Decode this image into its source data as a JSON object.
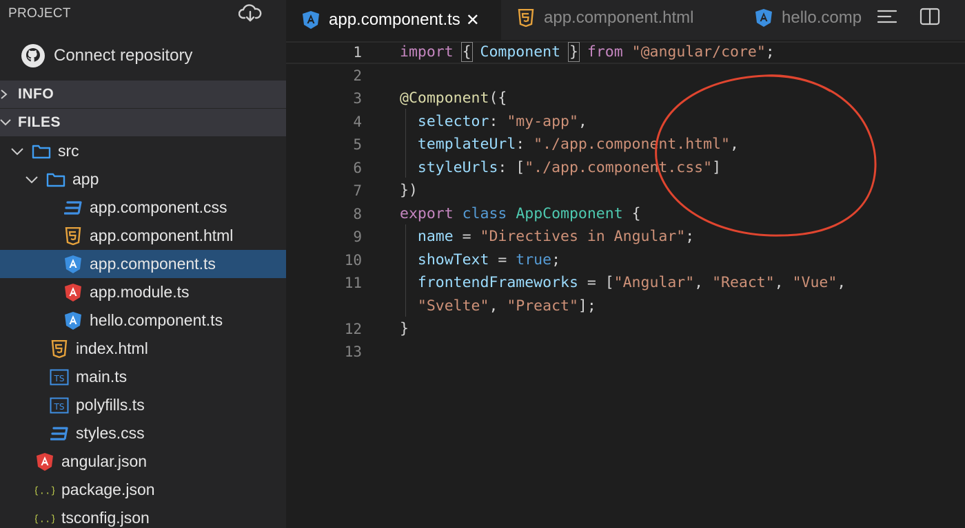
{
  "sidebar": {
    "title": "PROJECT",
    "connect_label": "Connect repository",
    "sections": {
      "info": "INFO",
      "files": "FILES"
    },
    "tree": [
      {
        "label": "src",
        "icon": "folder-icon"
      },
      {
        "label": "app",
        "icon": "folder-icon"
      },
      {
        "label": "app.component.css",
        "icon": "css-icon"
      },
      {
        "label": "app.component.html",
        "icon": "html5-icon"
      },
      {
        "label": "app.component.ts",
        "icon": "angular-ts-icon",
        "selected": true
      },
      {
        "label": "app.module.ts",
        "icon": "angular-icon"
      },
      {
        "label": "hello.component.ts",
        "icon": "angular-ts-icon"
      },
      {
        "label": "index.html",
        "icon": "html5-icon"
      },
      {
        "label": "main.ts",
        "icon": "typescript-icon"
      },
      {
        "label": "polyfills.ts",
        "icon": "typescript-icon"
      },
      {
        "label": "styles.css",
        "icon": "css-icon"
      },
      {
        "label": "angular.json",
        "icon": "angular-icon"
      },
      {
        "label": "package.json",
        "icon": "json-icon"
      },
      {
        "label": "tsconfig.json",
        "icon": "json-icon"
      }
    ]
  },
  "tabs": [
    {
      "label": "app.component.ts",
      "icon": "angular-ts-icon",
      "active": true,
      "close": "✕"
    },
    {
      "label": "app.component.html",
      "icon": "html5-icon"
    },
    {
      "label": "hello.comp",
      "icon": "angular-ts-icon"
    }
  ],
  "editor": {
    "line_numbers": [
      "1",
      "2",
      "3",
      "4",
      "5",
      "6",
      "7",
      "8",
      "9",
      "10",
      "11",
      "",
      "12",
      "13"
    ],
    "code": {
      "l1": {
        "kw": "import",
        "open": "{",
        "ident": "Component",
        "close": "}",
        "from": "from",
        "str": "\"@angular/core\"",
        "end": ";"
      },
      "l3": {
        "dec": "@Component",
        "rest": "({"
      },
      "l4": {
        "key": "selector",
        "sep": ": ",
        "val": "\"my-app\"",
        "end": ","
      },
      "l5": {
        "key": "templateUrl",
        "sep": ": ",
        "val": "\"./app.component.html\"",
        "end": ","
      },
      "l6": {
        "key": "styleUrls",
        "sep": ": [",
        "val": "\"./app.component.css\"",
        "end": "]"
      },
      "l7": {
        "text": "})"
      },
      "l8": {
        "kw": "export",
        "kw2": "class",
        "type": "AppComponent",
        "end": "{"
      },
      "l9": {
        "key": "name",
        "sep": " = ",
        "val": "\"Directives in Angular\"",
        "end": ";"
      },
      "l10": {
        "key": "showText",
        "sep": " = ",
        "val": "true",
        "end": ";"
      },
      "l11": {
        "key": "frontendFrameworks",
        "sep": " = [",
        "v1": "\"Angular\"",
        "c1": ", ",
        "v2": "\"React\"",
        "c2": ", ",
        "v3": "\"Vue\"",
        "end": ","
      },
      "l11b": {
        "v4": "\"Svelte\"",
        "c": ", ",
        "v5": "\"Preact\"",
        "end": "];"
      },
      "l12": {
        "text": "}"
      }
    }
  },
  "colors": {
    "annotation": "#e0452f",
    "angular_blue": "#3b8fe0",
    "angular_red": "#e0403b",
    "html_orange": "#e6a23c",
    "css_blue": "#3f8fe3"
  }
}
